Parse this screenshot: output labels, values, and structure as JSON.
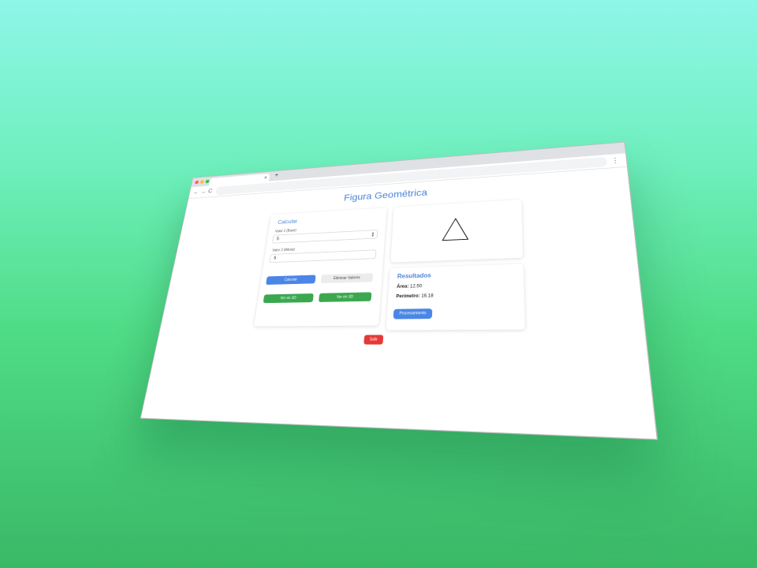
{
  "browser": {
    "new_tab": "+",
    "tab_close": "×",
    "back": "←",
    "forward": "→",
    "reload": "C",
    "menu": "⋮"
  },
  "page": {
    "title": "Figura Geométrica"
  },
  "calculator": {
    "heading": "Calcular",
    "field1_label": "Valor 1 (Base)",
    "field1_value": "5",
    "field2_label": "Valor 2 (Altura)",
    "field2_value": "5",
    "calculate_label": "Calcular",
    "clear_label": "Eliminar Valores",
    "view2d_label": "Ver en 2D",
    "view3d_label": "Ver en 3D"
  },
  "shape": {
    "icon": "triangle-outline"
  },
  "results": {
    "heading": "Resultados",
    "area_label": "Área:",
    "area_value": "12.50",
    "perimeter_label": "Perímetro:",
    "perimeter_value": "16.18",
    "process_label": "Procesamiento"
  },
  "footer": {
    "exit_label": "Salir"
  },
  "colors": {
    "accent": "#4a86e8",
    "success": "#3ba84f",
    "danger": "#e53935"
  }
}
